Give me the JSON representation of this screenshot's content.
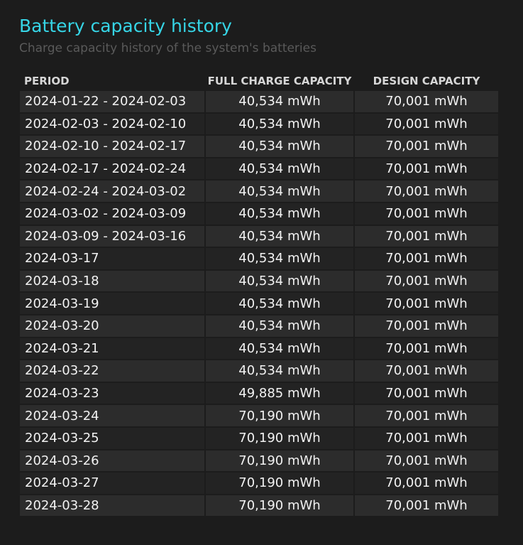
{
  "header": {
    "title": "Battery capacity history",
    "subtitle": "Charge capacity history of the system's batteries"
  },
  "table": {
    "columns": [
      "PERIOD",
      "FULL CHARGE CAPACITY",
      "DESIGN CAPACITY"
    ],
    "rows": [
      [
        "2024-01-22 - 2024-02-03",
        "40,534 mWh",
        "70,001 mWh"
      ],
      [
        "2024-02-03 - 2024-02-10",
        "40,534 mWh",
        "70,001 mWh"
      ],
      [
        "2024-02-10 - 2024-02-17",
        "40,534 mWh",
        "70,001 mWh"
      ],
      [
        "2024-02-17 - 2024-02-24",
        "40,534 mWh",
        "70,001 mWh"
      ],
      [
        "2024-02-24 - 2024-03-02",
        "40,534 mWh",
        "70,001 mWh"
      ],
      [
        "2024-03-02 - 2024-03-09",
        "40,534 mWh",
        "70,001 mWh"
      ],
      [
        "2024-03-09 - 2024-03-16",
        "40,534 mWh",
        "70,001 mWh"
      ],
      [
        "2024-03-17",
        "40,534 mWh",
        "70,001 mWh"
      ],
      [
        "2024-03-18",
        "40,534 mWh",
        "70,001 mWh"
      ],
      [
        "2024-03-19",
        "40,534 mWh",
        "70,001 mWh"
      ],
      [
        "2024-03-20",
        "40,534 mWh",
        "70,001 mWh"
      ],
      [
        "2024-03-21",
        "40,534 mWh",
        "70,001 mWh"
      ],
      [
        "2024-03-22",
        "40,534 mWh",
        "70,001 mWh"
      ],
      [
        "2024-03-23",
        "49,885 mWh",
        "70,001 mWh"
      ],
      [
        "2024-03-24",
        "70,190 mWh",
        "70,001 mWh"
      ],
      [
        "2024-03-25",
        "70,190 mWh",
        "70,001 mWh"
      ],
      [
        "2024-03-26",
        "70,190 mWh",
        "70,001 mWh"
      ],
      [
        "2024-03-27",
        "70,190 mWh",
        "70,001 mWh"
      ],
      [
        "2024-03-28",
        "70,190 mWh",
        "70,001 mWh"
      ]
    ]
  },
  "colors": {
    "title": "#36d5e6",
    "subtitle": "#5a5a5a",
    "background": "#1c1c1c",
    "row_odd": "#2c2c2c",
    "row_even": "#232323"
  }
}
